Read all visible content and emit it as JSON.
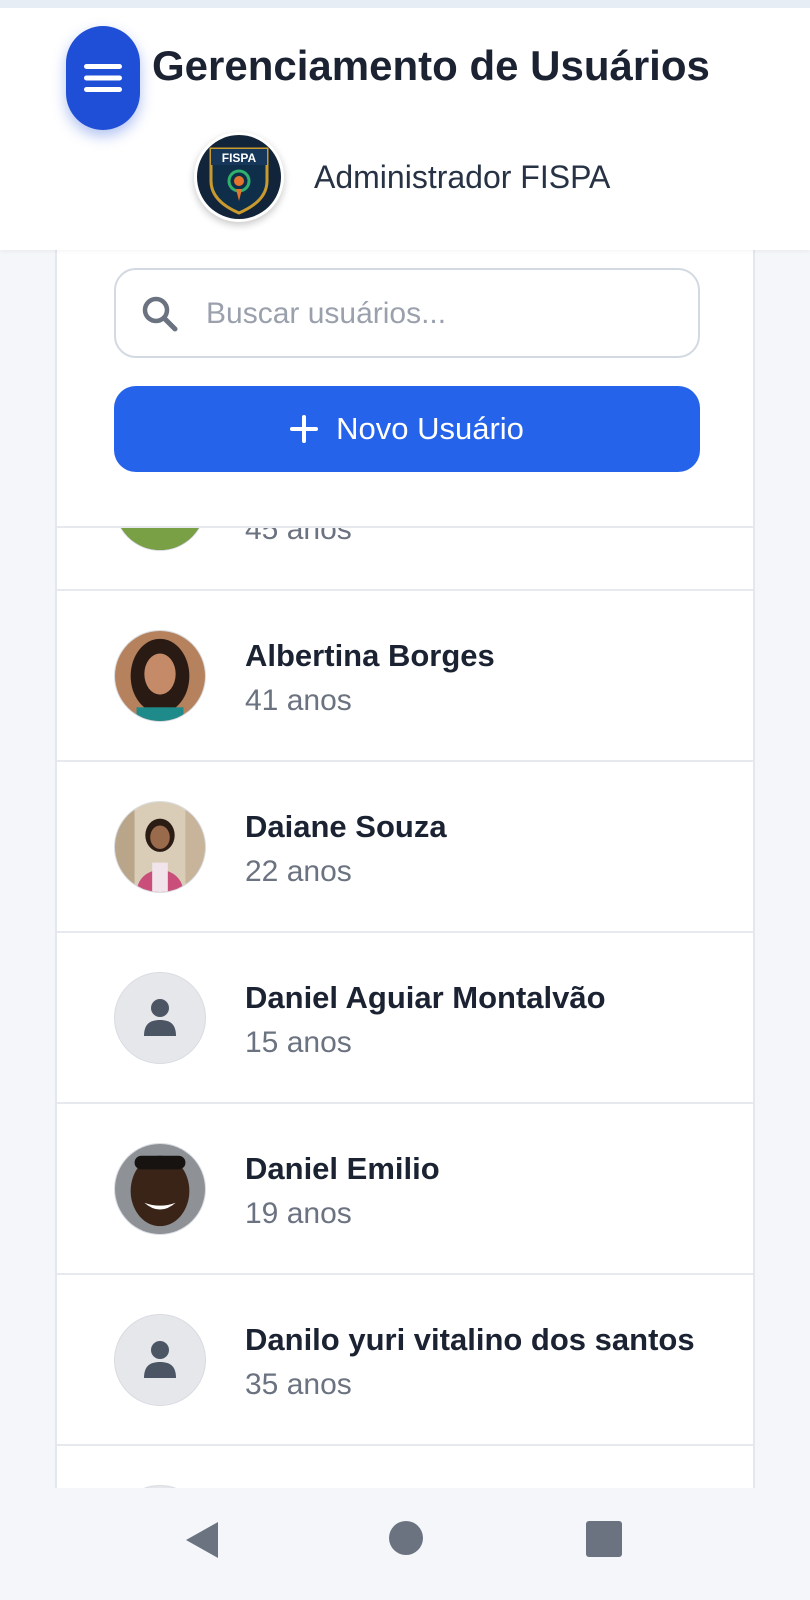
{
  "header": {
    "title": "Gerenciamento de Usuários",
    "admin_name": "Administrador FISPA",
    "logo_text": "FISPA",
    "menu_icon": "hamburger-menu-icon",
    "accent_color": "#1f4fd6"
  },
  "search": {
    "placeholder": "Buscar usuários...",
    "value": "",
    "icon": "search-icon"
  },
  "new_user_button": {
    "label": "Novo Usuário",
    "icon": "plus-icon",
    "color": "#2563eb"
  },
  "users": [
    {
      "name": "",
      "age": "45 anos",
      "avatar": "photo"
    },
    {
      "name": "Albertina Borges",
      "age": "41 anos",
      "avatar": "photo"
    },
    {
      "name": "Daiane Souza",
      "age": "22 anos",
      "avatar": "photo"
    },
    {
      "name": "Daniel Aguiar Montalvão",
      "age": "15 anos",
      "avatar": "person-placeholder-icon"
    },
    {
      "name": "Daniel Emilio",
      "age": "19 anos",
      "avatar": "photo"
    },
    {
      "name": "Danilo yuri vitalino dos santos",
      "age": "35 anos",
      "avatar": "person-placeholder-icon"
    }
  ],
  "navigation_bar": {
    "back_icon": "triangle-back-icon",
    "home_icon": "circle-home-icon",
    "recents_icon": "square-recents-icon"
  }
}
